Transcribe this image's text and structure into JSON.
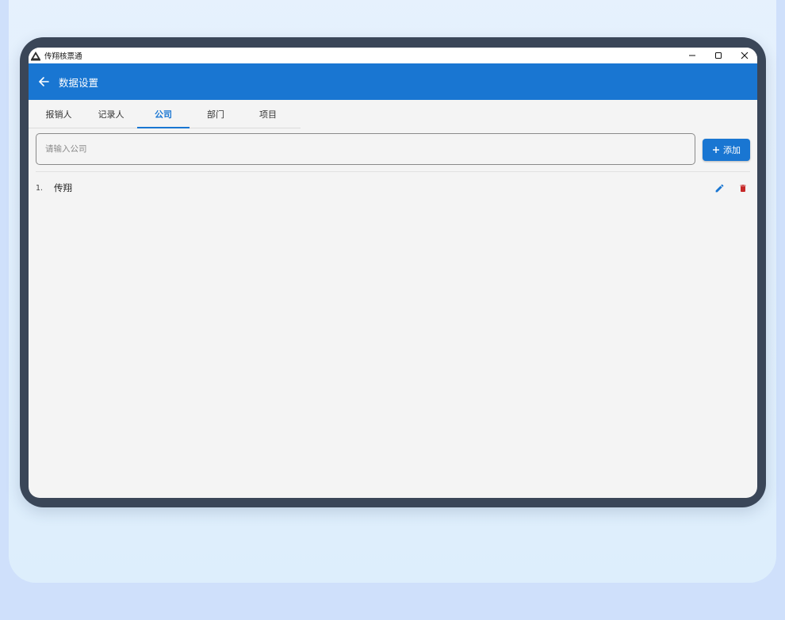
{
  "window": {
    "title": "传翔核票通"
  },
  "appbar": {
    "title": "数据设置"
  },
  "tabs": [
    {
      "label": "报销人",
      "active": false
    },
    {
      "label": "记录人",
      "active": false
    },
    {
      "label": "公司",
      "active": true
    },
    {
      "label": "部门",
      "active": false
    },
    {
      "label": "项目",
      "active": false
    }
  ],
  "form": {
    "input_placeholder": "请输入公司",
    "input_value": "",
    "add_label": "添加"
  },
  "list": {
    "items": [
      {
        "index": "1.",
        "name": "传翔"
      }
    ]
  },
  "colors": {
    "primary": "#1976d2",
    "delete": "#c62828",
    "device_frame": "#3a4658",
    "screen_bg": "#f4f4f4"
  },
  "icons": {
    "back": "arrow-left-icon",
    "add": "plus-icon",
    "edit": "pencil-icon",
    "delete": "trash-icon"
  }
}
